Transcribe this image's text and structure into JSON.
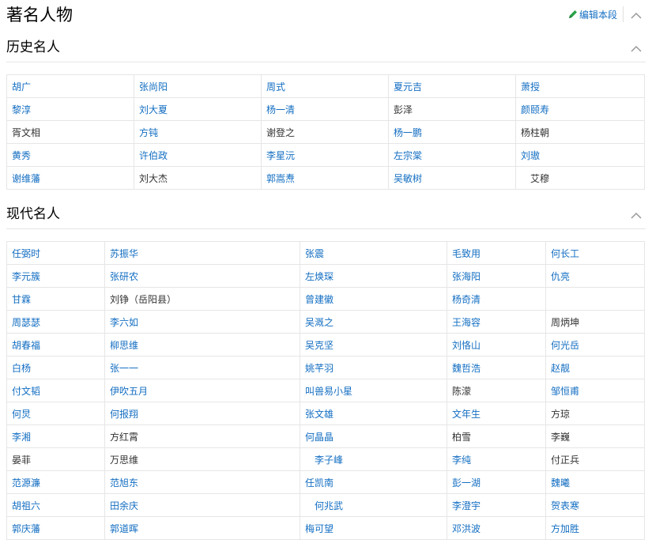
{
  "title": "著名人物",
  "edit_label": "编辑本段",
  "sections": [
    {
      "label": "历史名人",
      "rows": [
        [
          {
            "t": "胡广",
            "l": true
          },
          {
            "t": "张尚阳",
            "l": true
          },
          {
            "t": "周式",
            "l": true
          },
          {
            "t": "夏元吉",
            "l": true
          },
          {
            "t": "萧授",
            "l": true
          }
        ],
        [
          {
            "t": "黎淳",
            "l": true
          },
          {
            "t": "刘大夏",
            "l": true
          },
          {
            "t": "杨一清",
            "l": true
          },
          {
            "t": "彭泽",
            "l": false
          },
          {
            "t": "颜颐寿",
            "l": true
          }
        ],
        [
          {
            "t": "胥文相",
            "l": false
          },
          {
            "t": "方钝",
            "l": true
          },
          {
            "t": "谢登之",
            "l": false
          },
          {
            "t": "杨一鹏",
            "l": true
          },
          {
            "t": "杨柱朝",
            "l": false
          }
        ],
        [
          {
            "t": "黄秀",
            "l": true
          },
          {
            "t": "许伯政",
            "l": true
          },
          {
            "t": "李星沅",
            "l": true
          },
          {
            "t": "左宗棠",
            "l": true
          },
          {
            "t": "刘璈",
            "l": true
          }
        ],
        [
          {
            "t": "谢维藩",
            "l": true
          },
          {
            "t": "刘大杰",
            "l": false
          },
          {
            "t": "郭嵩焘",
            "l": true
          },
          {
            "t": "吴敏树",
            "l": true
          },
          {
            "t": "艾穆",
            "l": false,
            "pad": true
          }
        ]
      ]
    },
    {
      "label": "现代名人",
      "rows": [
        [
          {
            "t": "任弼时",
            "l": true
          },
          {
            "t": "苏振华",
            "l": true
          },
          {
            "t": "张震",
            "l": true
          },
          {
            "t": "毛致用",
            "l": true
          },
          {
            "t": "何长工",
            "l": true
          }
        ],
        [
          {
            "t": "李元簇",
            "l": true
          },
          {
            "t": "张研农",
            "l": true
          },
          {
            "t": "左焕琛",
            "l": true
          },
          {
            "t": "张海阳",
            "l": true
          },
          {
            "t": "仇亮",
            "l": true
          }
        ],
        [
          {
            "t": "甘霖",
            "l": true
          },
          {
            "t": "刘铮（岳阳县）",
            "l": false
          },
          {
            "t": "曾建徽",
            "l": true
          },
          {
            "t": "杨奇清",
            "l": true
          },
          {
            "t": "",
            "l": false
          }
        ],
        [
          {
            "t": "周瑟瑟",
            "l": true
          },
          {
            "t": "李六如",
            "l": true
          },
          {
            "t": "吴溉之",
            "l": true
          },
          {
            "t": "王海容",
            "l": true
          },
          {
            "t": "周炳坤",
            "l": false
          }
        ],
        [
          {
            "t": "胡春福",
            "l": true
          },
          {
            "t": "柳思维",
            "l": true
          },
          {
            "t": "吴克坚",
            "l": true
          },
          {
            "t": "刘恪山",
            "l": true
          },
          {
            "t": "何光岳",
            "l": true
          }
        ],
        [
          {
            "t": "白杨",
            "l": true
          },
          {
            "t": "张一一",
            "l": true
          },
          {
            "t": "姚芊羽",
            "l": true
          },
          {
            "t": "魏哲浩",
            "l": true
          },
          {
            "t": "赵靓",
            "l": true
          }
        ],
        [
          {
            "t": "付文韬",
            "l": true
          },
          {
            "t": "伊吹五月",
            "l": true
          },
          {
            "t": "叫兽易小星",
            "l": true
          },
          {
            "t": "陈濛",
            "l": false
          },
          {
            "t": "邹恒甫",
            "l": true
          }
        ],
        [
          {
            "t": "何炅",
            "l": true
          },
          {
            "t": "何报翔",
            "l": true
          },
          {
            "t": "张文雄",
            "l": true
          },
          {
            "t": "文年生",
            "l": true
          },
          {
            "t": "方琼",
            "l": false
          }
        ],
        [
          {
            "t": "李湘",
            "l": true
          },
          {
            "t": "方红霄",
            "l": false
          },
          {
            "t": "何晶晶",
            "l": true
          },
          {
            "t": "柏雪",
            "l": false
          },
          {
            "t": "李巍",
            "l": false
          }
        ],
        [
          {
            "t": "晏菲",
            "l": false
          },
          {
            "t": "万思维",
            "l": false
          },
          {
            "t": "李子峰",
            "l": true,
            "pad": true
          },
          {
            "t": "李纯",
            "l": true
          },
          {
            "t": "付正兵",
            "l": false
          }
        ],
        [
          {
            "t": "范源濂",
            "l": true
          },
          {
            "t": "范旭东",
            "l": true
          },
          {
            "t": "任凯南",
            "l": true
          },
          {
            "t": "彭一湖",
            "l": true
          },
          {
            "t": "魏曦",
            "l": true
          }
        ],
        [
          {
            "t": "胡祖六",
            "l": true
          },
          {
            "t": "田余庆",
            "l": true
          },
          {
            "t": "何兆武",
            "l": true,
            "pad": true
          },
          {
            "t": "李澄宇",
            "l": true
          },
          {
            "t": "贺表寒",
            "l": true
          }
        ],
        [
          {
            "t": "郭庆藩",
            "l": true
          },
          {
            "t": "郭道晖",
            "l": true
          },
          {
            "t": "梅可望",
            "l": true
          },
          {
            "t": "邓洪波",
            "l": true
          },
          {
            "t": "方加胜",
            "l": true
          }
        ]
      ]
    }
  ],
  "colors": {
    "link": "#136ec2",
    "edit_pen": "#2aa14a",
    "border": "#e6e6e6"
  },
  "icons": {
    "edit": "pencil-icon",
    "collapse": "chevron-up-icon"
  }
}
